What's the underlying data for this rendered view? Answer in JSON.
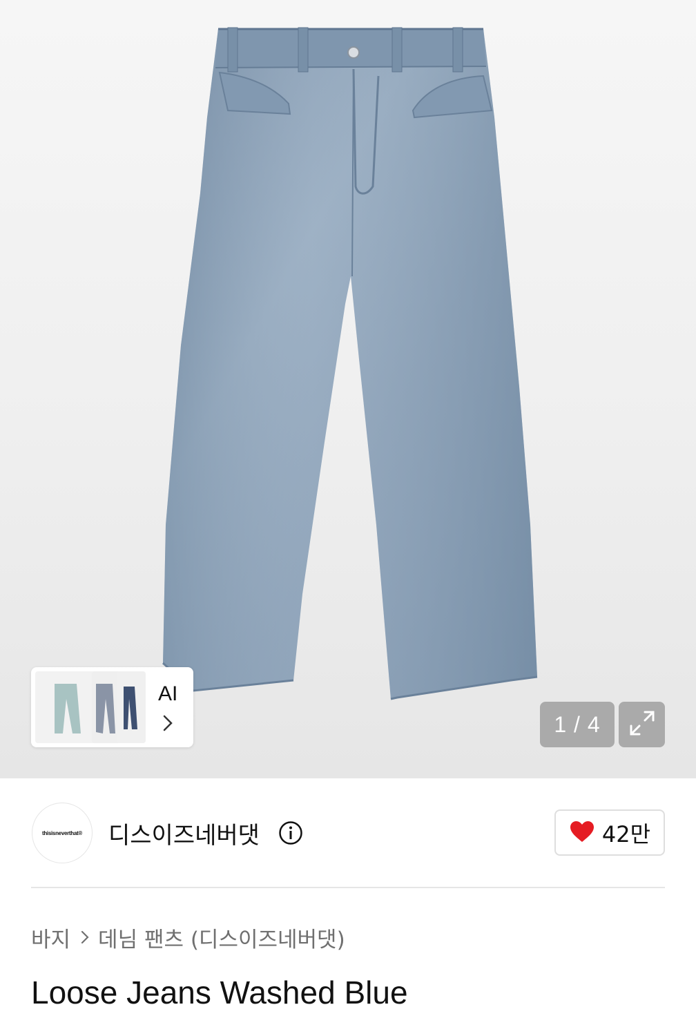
{
  "gallery": {
    "counter": "1 / 4",
    "product_image": "loose-jeans-washed-blue",
    "ai_recommend": {
      "label": "AI",
      "thumbnails": [
        "light-wash-jeans",
        "grey-jeans",
        "dark-blue-jeans"
      ]
    },
    "expand_icon": "expand-icon"
  },
  "brand": {
    "logo_text": "thisisneverthat®",
    "name": "디스이즈네버댓",
    "info_icon": "info-icon",
    "likes": "42만",
    "like_icon": "heart-icon",
    "heart_color": "#e51c23"
  },
  "breadcrumb": {
    "items": [
      "바지",
      "데님 팬츠 (디스이즈네버댓)"
    ],
    "separator_icon": "chevron-right-icon"
  },
  "product": {
    "title": "Loose Jeans Washed Blue"
  },
  "colors": {
    "denim": "#8aa0b7",
    "denim_dark": "#6f879f",
    "badge_bg": "#969696"
  }
}
